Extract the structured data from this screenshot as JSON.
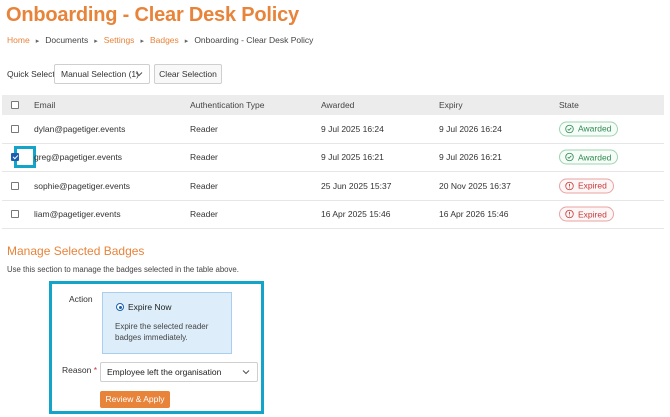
{
  "page": {
    "title": "Onboarding - Clear Desk Policy"
  },
  "breadcrumb": [
    {
      "label": "Home",
      "link": true
    },
    {
      "label": "Documents",
      "link": false
    },
    {
      "label": "Settings",
      "link": true
    },
    {
      "label": "Badges",
      "link": true
    },
    {
      "label": "Onboarding - Clear Desk Policy",
      "link": false
    }
  ],
  "quick_select": {
    "label": "Quick Select",
    "selected": "Manual Selection (1)",
    "clear_label": "Clear Selection"
  },
  "table": {
    "columns": [
      "Email",
      "Authentication Type",
      "Awarded",
      "Expiry",
      "State"
    ],
    "rows": [
      {
        "email": "dylan@pagetiger.events",
        "auth": "Reader",
        "awarded": "9 Jul 2025 16:24",
        "expiry": "9 Jul 2026 16:24",
        "state": "Awarded",
        "checked": false
      },
      {
        "email": "greg@pagetiger.events",
        "auth": "Reader",
        "awarded": "9 Jul 2025 16:21",
        "expiry": "9 Jul 2026 16:21",
        "state": "Awarded",
        "checked": true
      },
      {
        "email": "sophie@pagetiger.events",
        "auth": "Reader",
        "awarded": "25 Jun 2025 15:37",
        "expiry": "20 Nov 2025 16:37",
        "state": "Expired",
        "checked": false
      },
      {
        "email": "liam@pagetiger.events",
        "auth": "Reader",
        "awarded": "16 Apr 2025 15:46",
        "expiry": "16 Apr 2026 15:46",
        "state": "Expired",
        "checked": false
      }
    ]
  },
  "manage": {
    "title": "Manage Selected Badges",
    "description": "Use this section to manage the badges selected in the table above.",
    "action_label": "Action",
    "action_option": "Expire Now",
    "action_description": "Expire the selected reader badges immediately.",
    "reason_label": "Reason",
    "reason_required_mark": "*",
    "reason_value": "Employee left the organisation",
    "apply_label": "Review & Apply"
  },
  "colors": {
    "accent": "#e8833a",
    "highlight": "#14a3c9",
    "awarded": "#2e8a52",
    "expired": "#c83a3a"
  }
}
